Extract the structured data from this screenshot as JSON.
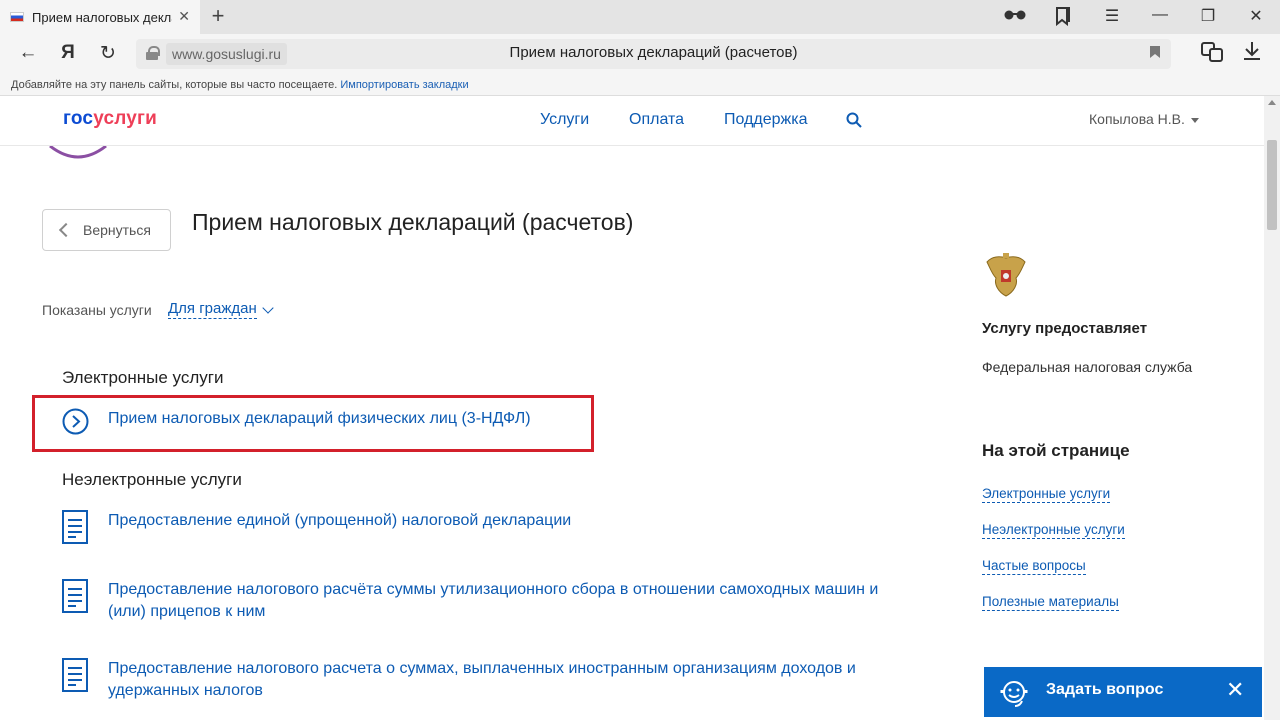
{
  "browser": {
    "tab": {
      "title": "Прием налоговых декла",
      "close": "✕"
    },
    "new_tab": "+",
    "window_controls": {
      "reader": "reader-glasses-icon",
      "collections": "collections-icon",
      "menu": "☰",
      "minimize": "—",
      "restore": "❐",
      "close": "✕"
    },
    "nav": {
      "back": "←",
      "yandex": "Я",
      "reload": "↻"
    },
    "address": {
      "domain": "www.gosuslugi.ru",
      "page_title": "Прием налоговых деклараций (расчетов)"
    },
    "bookmarks_bar": {
      "text": "Добавляйте на эту панель сайты, которые вы часто посещаете.",
      "import_link": "Импортировать закладки"
    }
  },
  "site": {
    "logo": {
      "part1": "гос",
      "part2": "услуги"
    },
    "menu": [
      "Услуги",
      "Оплата",
      "Поддержка"
    ],
    "user": "Копылова Н.В."
  },
  "page": {
    "back_label": "Вернуться",
    "title": "Прием налоговых деклараций (расчетов)",
    "filter": {
      "label": "Показаны услуги",
      "value": "Для граждан"
    },
    "electronic": {
      "heading": "Электронные услуги",
      "items": [
        "Прием налоговых деклараций физических лиц (3-НДФЛ)"
      ]
    },
    "non_electronic": {
      "heading": "Неэлектронные услуги",
      "items": [
        "Предоставление единой (упрощенной) налоговой декларации",
        "Предоставление налогового расчёта суммы утилизационного сбора в отношении самоходных машин и (или) прицепов к ним",
        "Предоставление налогового расчета о суммах, выплаченных иностранным организациям доходов и удержанных налогов"
      ]
    }
  },
  "sidebar": {
    "provider_heading": "Услугу предоставляет",
    "provider_value": "Федеральная налоговая служба",
    "onpage_heading": "На этой странице",
    "onpage_links": [
      "Электронные услуги",
      "Неэлектронные услуги",
      "Частые вопросы",
      "Полезные материалы"
    ]
  },
  "ask_widget": {
    "label": "Задать вопрос",
    "close": "✕"
  },
  "colors": {
    "accent": "#0d5bb3",
    "logo_blue": "#0d4cd3",
    "logo_red": "#ee3f58",
    "highlight": "#d3202b",
    "ask_bg": "#0a69c6"
  }
}
